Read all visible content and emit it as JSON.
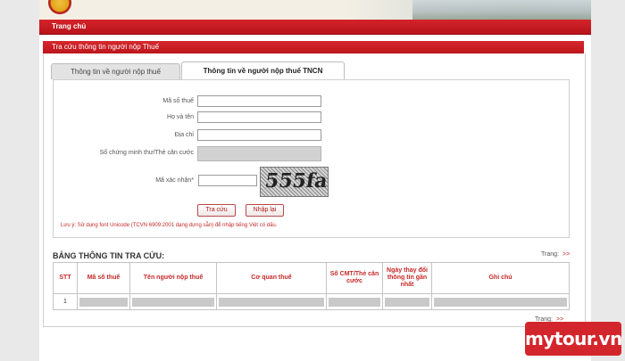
{
  "nav": {
    "home": "Trang chủ"
  },
  "section": {
    "title": "Tra cứu thông tin người nộp Thuế"
  },
  "tabs": [
    {
      "label": "Thông tin về người nộp thuế",
      "active": false
    },
    {
      "label": "Thông tin về người nộp thuế TNCN",
      "active": true
    }
  ],
  "form": {
    "tax_code_label": "Mã số thuế",
    "name_label": "Họ và tên",
    "address_label": "Địa chỉ",
    "id_label": "Số chứng minh thư/Thẻ căn cước",
    "captcha_label": "Mã xác nhận*",
    "captcha_text": "555fa",
    "search_button": "Tra cứu",
    "reset_button": "Nhập lại",
    "note": "Lưu ý: Sử dụng font Unicode (TCVN 6909:2001 dạng dựng sẵn) để nhập tiếng Việt có dấu."
  },
  "results": {
    "title": "BẢNG THÔNG TIN TRA CỨU:",
    "page_label": "Trang:",
    "page_next": ">>",
    "columns": [
      "STT",
      "Mã số thuế",
      "Tên người nộp thuế",
      "Cơ quan thuế",
      "Số CMT/Thẻ căn cước",
      "Ngày thay đổi thông tin gần nhất",
      "Ghi chú"
    ],
    "rows": [
      {
        "stt": "1"
      }
    ]
  },
  "watermark": "mytour.vn",
  "colors": {
    "accent": "#c62828",
    "nav": "#c41c22"
  }
}
